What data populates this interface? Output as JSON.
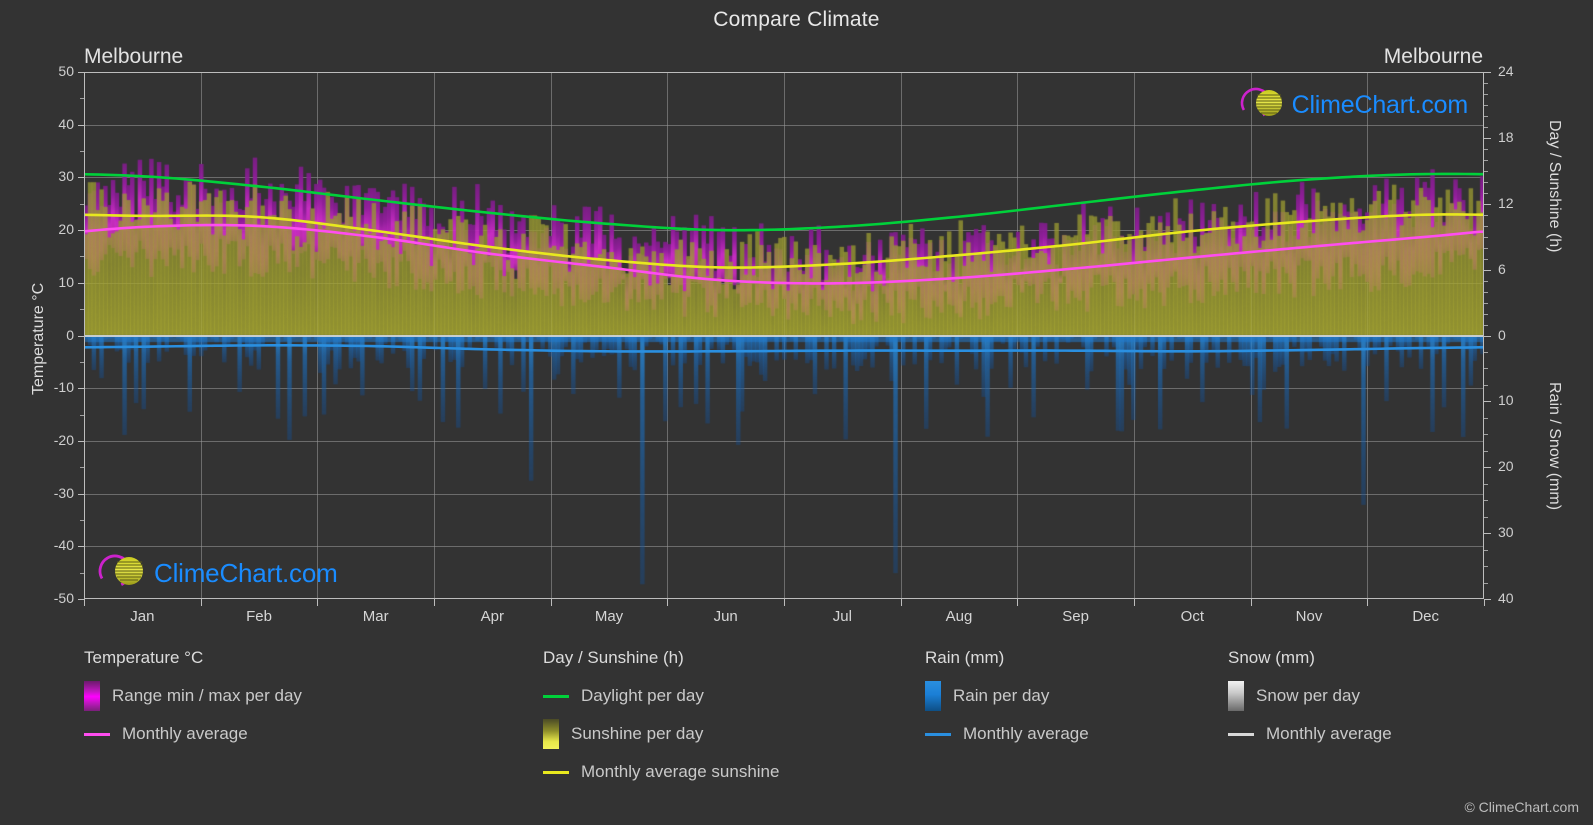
{
  "page": {
    "title": "Compare Climate",
    "background": "#333333",
    "copyright": "© ClimeChart.com",
    "brand": "ClimeChart.com"
  },
  "cities": {
    "left": "Melbourne",
    "right": "Melbourne"
  },
  "axes": {
    "left": {
      "title": "Temperature °C",
      "ticks": [
        50,
        40,
        30,
        20,
        10,
        0,
        -10,
        -20,
        -30,
        -40,
        -50
      ],
      "min": -50,
      "max": 50
    },
    "right_top": {
      "title": "Day / Sunshine (h)",
      "ticks": [
        24,
        18,
        12,
        6,
        0
      ],
      "min": 0,
      "max": 24
    },
    "right_bottom": {
      "title": "Rain / Snow (mm)",
      "ticks": [
        0,
        10,
        20,
        30,
        40
      ],
      "min": 0,
      "max": 40
    },
    "x": {
      "labels": [
        "Jan",
        "Feb",
        "Mar",
        "Apr",
        "May",
        "Jun",
        "Jul",
        "Aug",
        "Sep",
        "Oct",
        "Nov",
        "Dec"
      ]
    }
  },
  "legend": {
    "groups": [
      {
        "heading": "Temperature °C",
        "items": [
          {
            "label": "Range min / max per day",
            "swatch": "range",
            "kind": "temp"
          },
          {
            "label": "Monthly average",
            "swatch": "line",
            "color": "#ff4df0"
          }
        ]
      },
      {
        "heading": "Day / Sunshine (h)",
        "items": [
          {
            "label": "Daylight per day",
            "swatch": "line",
            "color": "#00d13a"
          },
          {
            "label": "Sunshine per day",
            "swatch": "range",
            "kind": "sun"
          },
          {
            "label": "Monthly average sunshine",
            "swatch": "line",
            "color": "#e8e81e"
          }
        ]
      },
      {
        "heading": "Rain (mm)",
        "items": [
          {
            "label": "Rain per day",
            "swatch": "range",
            "kind": "rain"
          },
          {
            "label": "Monthly average",
            "swatch": "line",
            "color": "#2a8fe0"
          }
        ]
      },
      {
        "heading": "Snow (mm)",
        "items": [
          {
            "label": "Snow per day",
            "swatch": "range",
            "kind": "snow"
          },
          {
            "label": "Monthly average",
            "swatch": "line",
            "color": "#d8d8d8"
          }
        ]
      }
    ]
  },
  "colors": {
    "background": "#333333",
    "grid": "#9a9a9a",
    "text": "#d8d8d8",
    "temp_line": "#ff4df0",
    "temp_range": "#cc00cc",
    "daylight_line": "#00d13a",
    "sunshine_line": "#e8e81e",
    "sunshine_range": "#b5b52e",
    "rain_line": "#2a8fe0",
    "rain_range": "#1b7fd6",
    "snow_range": "#cccccc",
    "brand_blue": "#1a8cff",
    "brand_magenta": "#cc22cc",
    "brand_yellow": "#d6d62a"
  },
  "chart_data": {
    "type": "area",
    "title": "Compare Climate",
    "subtitle": "Melbourne",
    "xlabel": "",
    "ylabel": "Temperature °C",
    "categories": [
      "Jan",
      "Feb",
      "Mar",
      "Apr",
      "May",
      "Jun",
      "Jul",
      "Aug",
      "Sep",
      "Oct",
      "Nov",
      "Dec"
    ],
    "axis_left": {
      "label": "Temperature °C",
      "min": -50,
      "max": 50,
      "ticks": [
        50,
        40,
        30,
        20,
        10,
        0,
        -10,
        -20,
        -30,
        -40,
        -50
      ]
    },
    "axis_right_top": {
      "label": "Day / Sunshine (h)",
      "min": 0,
      "max": 24,
      "ticks": [
        24,
        18,
        12,
        6,
        0
      ]
    },
    "axis_right_bottom": {
      "label": "Rain / Snow (mm)",
      "min": 0,
      "max": 40,
      "ticks": [
        0,
        10,
        20,
        30,
        40
      ]
    },
    "grid": true,
    "legend_position": "bottom",
    "series": [
      {
        "name": "Monthly average temperature",
        "unit": "°C",
        "color": "#ff4df0",
        "axis": "left",
        "values": [
          20.6,
          20.8,
          18.8,
          15.6,
          13.0,
          10.5,
          9.9,
          10.9,
          12.7,
          14.8,
          16.8,
          18.7
        ]
      },
      {
        "name": "Range max per day",
        "unit": "°C",
        "axis": "left",
        "values": [
          26.4,
          26.6,
          24.2,
          20.4,
          17.0,
          14.2,
          13.6,
          15.0,
          17.2,
          19.8,
          22.2,
          24.4
        ]
      },
      {
        "name": "Range min per day",
        "unit": "°C",
        "axis": "left",
        "values": [
          14.8,
          15.0,
          13.4,
          10.8,
          8.9,
          6.9,
          6.2,
          6.8,
          8.2,
          9.8,
          11.5,
          13.0
        ]
      },
      {
        "name": "Daylight per day",
        "unit": "h",
        "color": "#00d13a",
        "axis": "right_top",
        "values": [
          14.5,
          13.6,
          12.4,
          11.2,
          10.2,
          9.6,
          9.9,
          10.8,
          12.0,
          13.2,
          14.2,
          14.7
        ]
      },
      {
        "name": "Monthly average sunshine",
        "unit": "h",
        "color": "#e8e81e",
        "axis": "right_top",
        "values": [
          10.9,
          10.8,
          9.6,
          8.1,
          6.9,
          6.2,
          6.5,
          7.3,
          8.3,
          9.5,
          10.4,
          11.0
        ]
      },
      {
        "name": "Rain monthly average",
        "unit": "mm",
        "color": "#2a8fe0",
        "axis": "right_bottom",
        "values": [
          1.7,
          1.5,
          1.6,
          2.1,
          2.4,
          2.4,
          2.3,
          2.3,
          2.3,
          2.4,
          2.2,
          1.9
        ]
      },
      {
        "name": "Snow monthly average",
        "unit": "mm",
        "color": "#d8d8d8",
        "axis": "right_bottom",
        "values": [
          0,
          0,
          0,
          0,
          0,
          0,
          0,
          0,
          0,
          0,
          0,
          0
        ]
      }
    ]
  }
}
